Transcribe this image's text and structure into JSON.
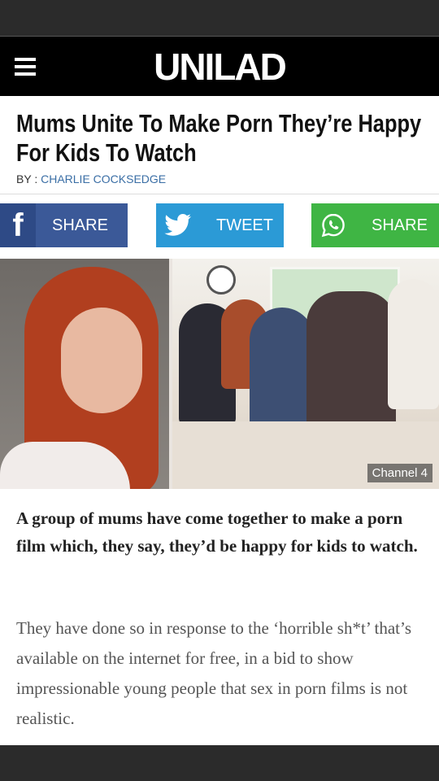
{
  "header": {
    "logo_text": "UNILAD"
  },
  "article": {
    "title": "Mums Unite To Make Porn They’re Happy For Kids To Watch",
    "byline_prefix": "BY : ",
    "author": "CHARLIE COCKSEDGE",
    "image_credit": "Channel 4",
    "lead": "A group of mums have come together to make a porn film which, they say, they’d be happy for kids to watch.",
    "body": "They have done so in response to the ‘horrible sh*t’ that’s available on the internet for free, in a bid to show impressionable young people that sex in porn films is not realistic."
  },
  "share": {
    "facebook_icon": "f",
    "facebook_label": "SHARE",
    "twitter_label": "TWEET",
    "whatsapp_label": "SHARE"
  },
  "colors": {
    "facebook": "#3b5998",
    "twitter": "#2b9ad6",
    "whatsapp": "#3fb544",
    "author_link": "#3a6ea5"
  },
  "icons": [
    "menu-icon",
    "facebook-icon",
    "twitter-bird-icon",
    "whatsapp-icon"
  ]
}
